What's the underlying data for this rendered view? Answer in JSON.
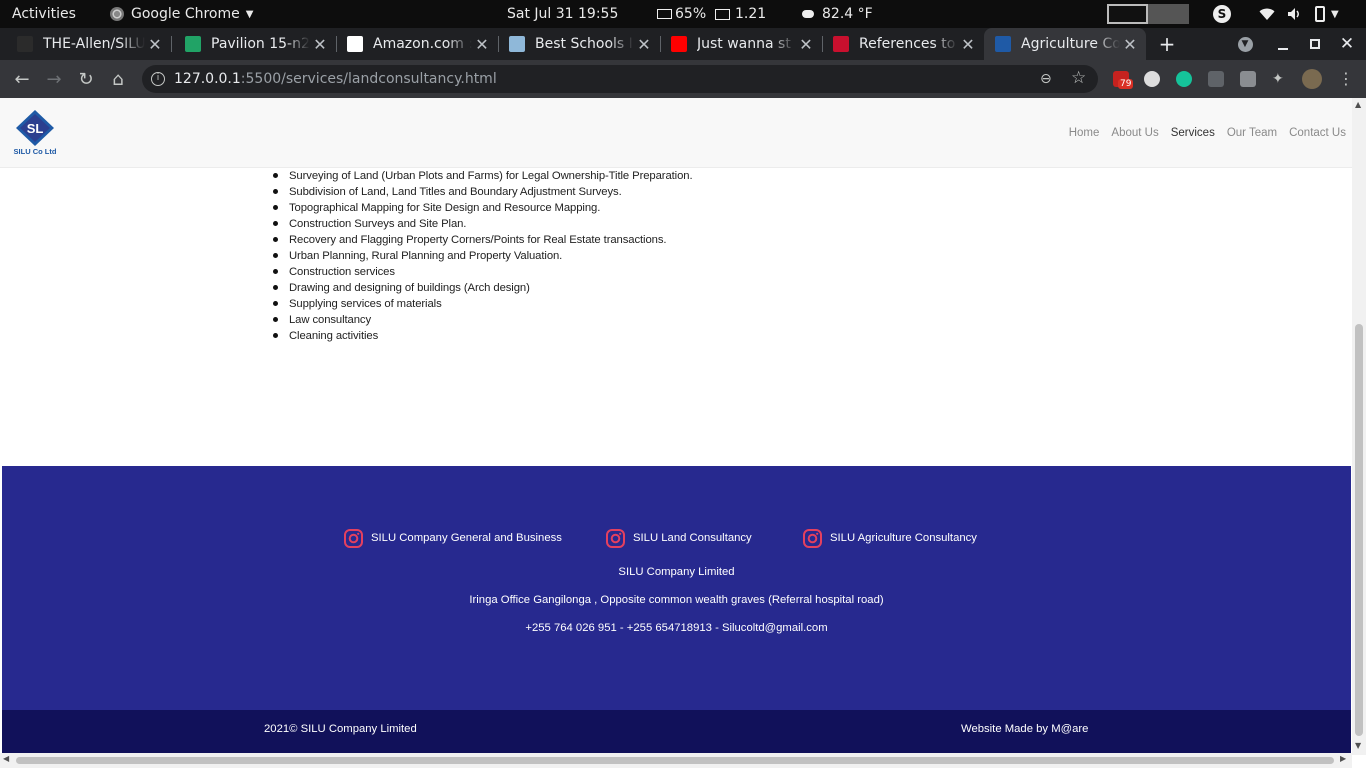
{
  "system": {
    "activities": "Activities",
    "app_menu": "Google Chrome",
    "clock": "Sat Jul 31  19:55",
    "battery": "65%",
    "cpu": "1.21",
    "weather": "82.4 °F"
  },
  "tabs": [
    {
      "title": "THE-Allen/SILU",
      "favicon": "github-icon",
      "color": "#2b2b2b"
    },
    {
      "title": "Pavilion 15-n2",
      "favicon": "sheet-icon",
      "color": "#21a366"
    },
    {
      "title": "Amazon.com :",
      "favicon": "amazon-icon",
      "color": "#ffffff"
    },
    {
      "title": "Best Schools In",
      "favicon": "school-icon",
      "color": "#8fb8d9"
    },
    {
      "title": "Just wanna st",
      "favicon": "youtube-icon",
      "color": "#ff0000"
    },
    {
      "title": "References to",
      "favicon": "references-icon",
      "color": "#c8102e"
    },
    {
      "title": "Agriculture Co",
      "favicon": "silu-icon",
      "color": "#1f5aa6"
    }
  ],
  "browser": {
    "url_host": "127.0.0.1",
    "url_rest": ":5500/services/landconsultancy.html",
    "mail_badge": "79"
  },
  "site": {
    "logo_initials": "SL",
    "logo_caption": "SILU Co Ltd",
    "nav": [
      {
        "label": "Home",
        "active": false
      },
      {
        "label": "About Us",
        "active": false
      },
      {
        "label": "Services",
        "active": true
      },
      {
        "label": "Our Team",
        "active": false
      },
      {
        "label": "Contact Us",
        "active": false
      }
    ],
    "services": [
      "Surveying of Land (Urban Plots and Farms) for Legal Ownership-Title Preparation.",
      "Subdivision of Land, Land Titles and Boundary Adjustment Surveys.",
      "Topographical Mapping for Site Design and Resource Mapping.",
      "Construction Surveys and Site Plan.",
      "Recovery and Flagging Property Corners/Points for Real Estate transactions.",
      "Urban Planning, Rural Planning and Property Valuation.",
      "Construction services",
      "Drawing and designing of buildings (Arch design)",
      "Supplying services of materials",
      "Law consultancy",
      "Cleaning activities"
    ],
    "footer": {
      "social": [
        "SILU Company General and Business",
        "SILU Land Consultancy",
        "SILU Agriculture Consultancy"
      ],
      "company": "SILU Company Limited",
      "address": "Iringa Office Gangilonga , Opposite common wealth graves (Referral hospital road)",
      "contact": "+255 764 026 951 - +255 654718913 - Silucoltd@gmail.com",
      "copyright": "2021© SILU Company Limited",
      "credit": "Website Made by M@are"
    }
  },
  "colors": {
    "footer_bg": "#27298f",
    "subfooter_bg": "#11115a",
    "instagram": "#e4405f"
  }
}
